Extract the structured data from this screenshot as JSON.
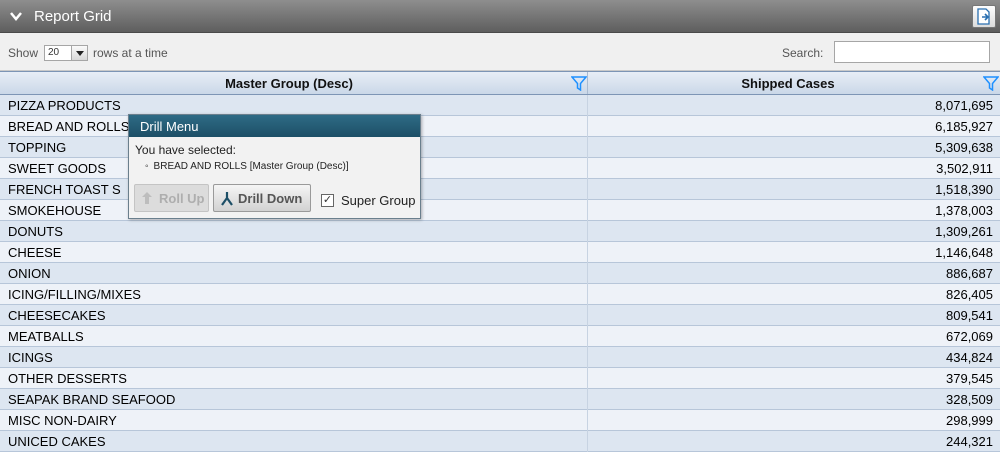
{
  "panel": {
    "title": "Report Grid"
  },
  "toolbar": {
    "show_label": "Show",
    "rows_value": "20",
    "rows_suffix": "rows at a time",
    "search_label": "Search:",
    "search_value": ""
  },
  "grid": {
    "columns": [
      "Master Group (Desc)",
      "Shipped Cases"
    ],
    "rows": [
      [
        "PIZZA PRODUCTS",
        "8,071,695"
      ],
      [
        "BREAD AND ROLLS",
        "6,185,927"
      ],
      [
        "TOPPING",
        "5,309,638"
      ],
      [
        "SWEET GOODS",
        "3,502,911"
      ],
      [
        "FRENCH TOAST S",
        "1,518,390"
      ],
      [
        "SMOKEHOUSE",
        "1,378,003"
      ],
      [
        "DONUTS",
        "1,309,261"
      ],
      [
        "CHEESE",
        "1,146,648"
      ],
      [
        "ONION",
        "886,687"
      ],
      [
        "ICING/FILLING/MIXES",
        "826,405"
      ],
      [
        "CHEESECAKES",
        "809,541"
      ],
      [
        "MEATBALLS",
        "672,069"
      ],
      [
        "ICINGS",
        "434,824"
      ],
      [
        "OTHER DESSERTS",
        "379,545"
      ],
      [
        "SEAPAK BRAND SEAFOOD",
        "328,509"
      ],
      [
        "MISC NON-DAIRY",
        "298,999"
      ],
      [
        "UNICED CAKES",
        "244,321"
      ]
    ]
  },
  "drill_menu": {
    "title": "Drill Menu",
    "selected_label": "You have selected:",
    "selected_item": "BREAD AND ROLLS [Master Group (Desc)]",
    "roll_up_label": "Roll Up",
    "drill_down_label": "Drill Down",
    "super_group_label": "Super Group",
    "super_group_checked": true
  },
  "colors": {
    "header_bar": "#6e6e6e",
    "grid_header": "#cad8e8",
    "row_odd": "#dde6f1",
    "row_even": "#eef2f8",
    "drill_header": "#235a73",
    "filter_icon": "#1e90ff"
  },
  "icons": [
    "chevron-down-icon",
    "export-icon",
    "filter-icon",
    "roll-up-icon",
    "drill-down-icon",
    "checkbox-checked-icon"
  ]
}
